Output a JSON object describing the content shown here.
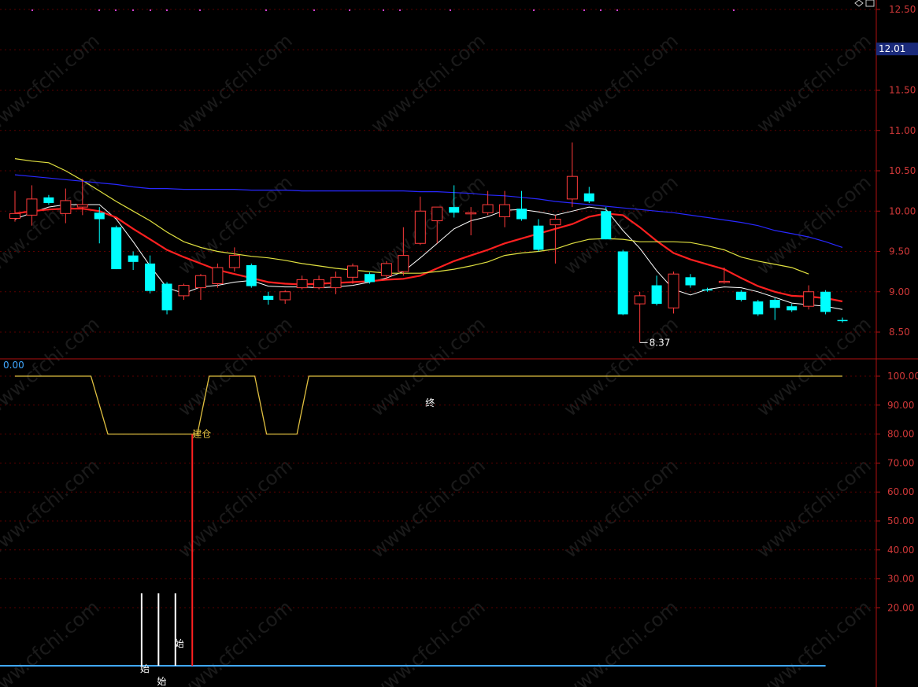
{
  "chart_data": [
    {
      "type": "candlestick",
      "ylim": [
        8.3,
        12.5
      ],
      "y_ticks": [
        "12.50",
        "12.00",
        "11.50",
        "11.00",
        "10.50",
        "10.00",
        "9.50",
        "9.00",
        "8.50"
      ],
      "current_price_label": "12.01",
      "low_marker_label": "8.37",
      "grid": true,
      "colors": {
        "up": "#ff3b3b",
        "down": "#00ffff",
        "background": "#000000",
        "grid": "#5a0000",
        "axis": "#b01010"
      },
      "candles": [
        {
          "o": 9.91,
          "h": 10.25,
          "l": 9.87,
          "c": 9.97
        },
        {
          "o": 9.95,
          "h": 10.32,
          "l": 9.82,
          "c": 10.15
        },
        {
          "o": 10.17,
          "h": 10.2,
          "l": 10.08,
          "c": 10.1
        },
        {
          "o": 9.97,
          "h": 10.28,
          "l": 9.85,
          "c": 10.13
        },
        {
          "o": 10.05,
          "h": 10.4,
          "l": 9.95,
          "c": 10.08
        },
        {
          "o": 9.98,
          "h": 10.05,
          "l": 9.6,
          "c": 9.9
        },
        {
          "o": 9.8,
          "h": 9.82,
          "l": 9.28,
          "c": 9.28
        },
        {
          "o": 9.45,
          "h": 9.5,
          "l": 9.27,
          "c": 9.37
        },
        {
          "o": 9.35,
          "h": 9.45,
          "l": 8.98,
          "c": 9.01
        },
        {
          "o": 9.1,
          "h": 9.12,
          "l": 8.72,
          "c": 8.77
        },
        {
          "o": 8.95,
          "h": 9.1,
          "l": 8.9,
          "c": 9.08
        },
        {
          "o": 9.05,
          "h": 9.22,
          "l": 8.9,
          "c": 9.2
        },
        {
          "o": 9.1,
          "h": 9.35,
          "l": 9.05,
          "c": 9.3
        },
        {
          "o": 9.3,
          "h": 9.55,
          "l": 9.25,
          "c": 9.45
        },
        {
          "o": 9.33,
          "h": 9.35,
          "l": 9.05,
          "c": 9.07
        },
        {
          "o": 8.95,
          "h": 9.0,
          "l": 8.84,
          "c": 8.9
        },
        {
          "o": 8.9,
          "h": 9.02,
          "l": 8.85,
          "c": 9.0
        },
        {
          "o": 9.05,
          "h": 9.2,
          "l": 9.03,
          "c": 9.15
        },
        {
          "o": 9.05,
          "h": 9.2,
          "l": 9.03,
          "c": 9.15
        },
        {
          "o": 9.05,
          "h": 9.25,
          "l": 8.97,
          "c": 9.18
        },
        {
          "o": 9.18,
          "h": 9.35,
          "l": 9.1,
          "c": 9.32
        },
        {
          "o": 9.22,
          "h": 9.24,
          "l": 9.1,
          "c": 9.12
        },
        {
          "o": 9.2,
          "h": 9.38,
          "l": 9.15,
          "c": 9.35
        },
        {
          "o": 9.25,
          "h": 9.8,
          "l": 9.2,
          "c": 9.45
        },
        {
          "o": 9.6,
          "h": 10.18,
          "l": 9.58,
          "c": 10.0
        },
        {
          "o": 9.88,
          "h": 10.05,
          "l": 9.6,
          "c": 10.05
        },
        {
          "o": 10.05,
          "h": 10.32,
          "l": 9.92,
          "c": 9.98
        },
        {
          "o": 9.98,
          "h": 10.05,
          "l": 9.7,
          "c": 9.98
        },
        {
          "o": 9.98,
          "h": 10.25,
          "l": 9.95,
          "c": 10.08
        },
        {
          "o": 9.93,
          "h": 10.25,
          "l": 9.8,
          "c": 10.08
        },
        {
          "o": 10.03,
          "h": 10.25,
          "l": 9.88,
          "c": 9.9
        },
        {
          "o": 9.82,
          "h": 9.9,
          "l": 9.5,
          "c": 9.52
        },
        {
          "o": 9.83,
          "h": 9.95,
          "l": 9.35,
          "c": 9.9
        },
        {
          "o": 10.15,
          "h": 10.85,
          "l": 10.05,
          "c": 10.43
        },
        {
          "o": 10.22,
          "h": 10.3,
          "l": 10.1,
          "c": 10.12
        },
        {
          "o": 10.0,
          "h": 10.05,
          "l": 9.65,
          "c": 9.65
        },
        {
          "o": 9.5,
          "h": 9.52,
          "l": 8.71,
          "c": 8.72
        },
        {
          "o": 8.85,
          "h": 9.0,
          "l": 8.37,
          "c": 8.95
        },
        {
          "o": 9.08,
          "h": 9.2,
          "l": 8.83,
          "c": 8.85
        },
        {
          "o": 8.8,
          "h": 9.25,
          "l": 8.73,
          "c": 9.22
        },
        {
          "o": 9.18,
          "h": 9.22,
          "l": 9.05,
          "c": 9.08
        },
        {
          "o": 9.03,
          "h": 9.05,
          "l": 9.0,
          "c": 9.02
        },
        {
          "o": 9.12,
          "h": 9.3,
          "l": 9.1,
          "c": 9.13
        },
        {
          "o": 9.0,
          "h": 9.02,
          "l": 8.88,
          "c": 8.9
        },
        {
          "o": 8.88,
          "h": 8.9,
          "l": 8.7,
          "c": 8.72
        },
        {
          "o": 8.9,
          "h": 8.92,
          "l": 8.65,
          "c": 8.8
        },
        {
          "o": 8.82,
          "h": 8.85,
          "l": 8.75,
          "c": 8.77
        },
        {
          "o": 8.82,
          "h": 9.08,
          "l": 8.78,
          "c": 9.0
        },
        {
          "o": 9.0,
          "h": 9.02,
          "l": 8.72,
          "c": 8.75
        },
        {
          "o": 8.65,
          "h": 8.68,
          "l": 8.62,
          "c": 8.64
        }
      ],
      "series": [
        {
          "color": "#ffffff",
          "values": [
            9.9,
            9.98,
            10.05,
            10.08,
            10.08,
            10.08,
            9.9,
            9.62,
            9.32,
            9.05,
            8.98,
            9.06,
            9.08,
            9.12,
            9.14,
            9.07,
            9.06,
            9.06,
            9.05,
            9.06,
            9.08,
            9.12,
            9.17,
            9.25,
            9.42,
            9.6,
            9.78,
            9.88,
            9.93,
            10.01,
            10.02,
            9.99,
            9.95,
            10.0,
            10.05,
            10.02,
            9.76,
            9.54,
            9.26,
            9.03,
            8.96,
            9.03,
            9.06,
            9.05,
            9.0,
            8.93,
            8.86,
            8.84,
            8.82,
            8.78
          ]
        },
        {
          "color": "#ff2020",
          "values": [
            9.97,
            10.0,
            10.02,
            10.03,
            10.03,
            10.0,
            9.92,
            9.78,
            9.65,
            9.52,
            9.43,
            9.35,
            9.27,
            9.22,
            9.17,
            9.12,
            9.1,
            9.09,
            9.1,
            9.11,
            9.12,
            9.13,
            9.15,
            9.16,
            9.2,
            9.29,
            9.38,
            9.45,
            9.52,
            9.6,
            9.66,
            9.72,
            9.78,
            9.84,
            9.93,
            9.97,
            9.95,
            9.8,
            9.63,
            9.48,
            9.4,
            9.34,
            9.28,
            9.17,
            9.07,
            9.0,
            8.95,
            8.94,
            8.92,
            8.88
          ]
        },
        {
          "color": "#e0e040",
          "values": [
            10.65,
            10.62,
            10.6,
            10.5,
            10.38,
            10.25,
            10.12,
            10.0,
            9.88,
            9.74,
            9.62,
            9.55,
            9.5,
            9.47,
            9.44,
            9.42,
            9.39,
            9.35,
            9.32,
            9.29,
            9.27,
            9.25,
            9.23,
            9.23,
            9.23,
            9.25,
            9.28,
            9.32,
            9.37,
            9.45,
            9.48,
            9.5,
            9.53,
            9.6,
            9.65,
            9.66,
            9.65,
            9.62,
            9.62,
            9.62,
            9.61,
            9.57,
            9.52,
            9.43,
            9.38,
            9.34,
            9.3,
            9.22
          ]
        },
        {
          "color": "#2828ff",
          "values": [
            10.45,
            10.43,
            10.41,
            10.39,
            10.37,
            10.35,
            10.33,
            10.3,
            10.28,
            10.28,
            10.27,
            10.27,
            10.27,
            10.27,
            10.26,
            10.26,
            10.26,
            10.25,
            10.25,
            10.25,
            10.25,
            10.25,
            10.25,
            10.25,
            10.24,
            10.24,
            10.23,
            10.22,
            10.2,
            10.19,
            10.17,
            10.15,
            10.12,
            10.1,
            10.08,
            10.06,
            10.04,
            10.02,
            10.0,
            9.98,
            9.95,
            9.92,
            9.89,
            9.86,
            9.82,
            9.76,
            9.72,
            9.68,
            9.62,
            9.55
          ]
        }
      ]
    },
    {
      "type": "line",
      "ylim": [
        0,
        105
      ],
      "y_ticks": [
        "100.00",
        "90.00",
        "80.00",
        "70.00",
        "60.00",
        "50.00",
        "40.00",
        "30.00",
        "20.00"
      ],
      "corner_value": "0.00",
      "colors": {
        "series": "#e0c040",
        "baseline": "#40a8ff",
        "signal": "#ff2020",
        "marker": "#ffffff"
      },
      "series": [
        {
          "x": [
            0,
            4.5,
            5.5,
            10.8,
            11.5,
            14.2,
            14.9,
            16.7,
            17.4,
            49
          ],
          "values": [
            100,
            100,
            80,
            80,
            100,
            100,
            80,
            80,
            100,
            100
          ]
        }
      ],
      "baseline": 0,
      "annotations": {
        "build": "建仓",
        "end": "终",
        "start": "始"
      },
      "markers_x": [
        7.5,
        8.5,
        9.5
      ],
      "signal_x": 10.5
    }
  ]
}
